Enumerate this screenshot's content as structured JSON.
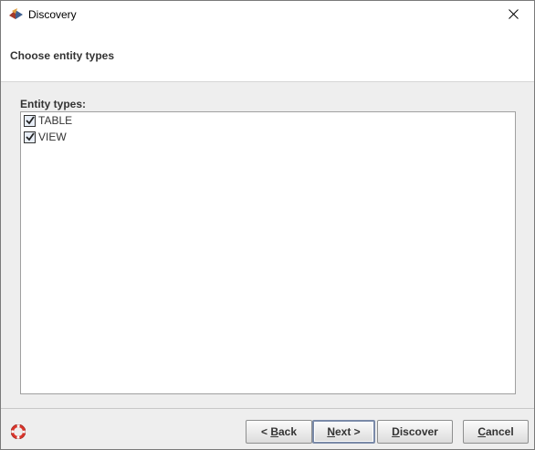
{
  "window": {
    "title": "Discovery",
    "app_icon": "cayenne-icon",
    "close_icon": "close-icon"
  },
  "header": {
    "title": "Choose entity types"
  },
  "entity_types": {
    "label": "Entity types:",
    "items": [
      {
        "label": "TABLE",
        "checked": true
      },
      {
        "label": "VIEW",
        "checked": true
      }
    ]
  },
  "footer": {
    "help_icon": "help-lifebuoy-icon",
    "buttons": {
      "back": {
        "prefix": "< ",
        "mnemonic": "B",
        "rest": "ack"
      },
      "next": {
        "mnemonic": "N",
        "rest": "ext >"
      },
      "discover": {
        "mnemonic": "D",
        "rest": "iscover"
      },
      "cancel": {
        "mnemonic": "C",
        "rest": "ancel"
      }
    }
  }
}
